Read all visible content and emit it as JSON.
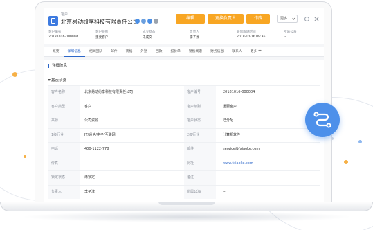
{
  "header": {
    "crumb": "客户",
    "title": "北京易动纷享科技有限责任公司",
    "buttons": {
      "edit": "编辑",
      "change_owner": "更换负责人",
      "void": "作废",
      "more": "更多"
    },
    "meta": [
      {
        "key": "客户编号",
        "value": "20181016-000004"
      },
      {
        "key": "客户级别",
        "value": "重要客户"
      },
      {
        "key": "成交状态",
        "value": "未成交"
      },
      {
        "key": "负责人",
        "value": "李子淳"
      },
      {
        "key": "最后跟进时间",
        "value": "2018-10-16 09:36"
      },
      {
        "key": "所属公海",
        "value": "--"
      }
    ]
  },
  "tabs": [
    {
      "label": "概要"
    },
    {
      "label": "详细信息"
    },
    {
      "label": "相关团队"
    },
    {
      "label": "邮件"
    },
    {
      "label": "商机"
    },
    {
      "label": "外勤"
    },
    {
      "label": "回款"
    },
    {
      "label": "报价单"
    },
    {
      "label": "销售线索"
    },
    {
      "label": "财务信息"
    },
    {
      "label": "联系人"
    },
    {
      "label": "更多"
    }
  ],
  "content": {
    "section_title": "详细信息",
    "subsection_title": "基本信息",
    "rows": [
      {
        "lk": "客户名称",
        "lv": "北京易动纷享科技有限责任公司",
        "rk": "客户编号",
        "rv": "20181016-000004"
      },
      {
        "lk": "客户类型",
        "lv": "客户",
        "rk": "客户级别",
        "rv": "重要客户"
      },
      {
        "lk": "来源",
        "lv": "公司资源",
        "rk": "客户状态",
        "rv": "已分配"
      },
      {
        "lk": "1级行业",
        "lv": "IT/通信/电子/互联网",
        "rk": "2级行业",
        "rv": "计算机软件"
      },
      {
        "lk": "电话",
        "lv": "400-1122-778",
        "rk": "邮件",
        "rv": "service@fxiaoke.com"
      },
      {
        "lk": "传真",
        "lv": "--",
        "rk": "网址",
        "rv": "www.fxiaoke.com"
      },
      {
        "lk": "锁定状态",
        "lv": "未锁定",
        "rk": "备注",
        "rv": "--"
      },
      {
        "lk": "负责人",
        "lv": "李子淳",
        "rk": "所属公海",
        "rv": "--"
      }
    ]
  },
  "colors": {
    "accent_orange": "#f8a623",
    "primary_blue": "#2b66c9",
    "badge_blue": "#4d90ea"
  }
}
